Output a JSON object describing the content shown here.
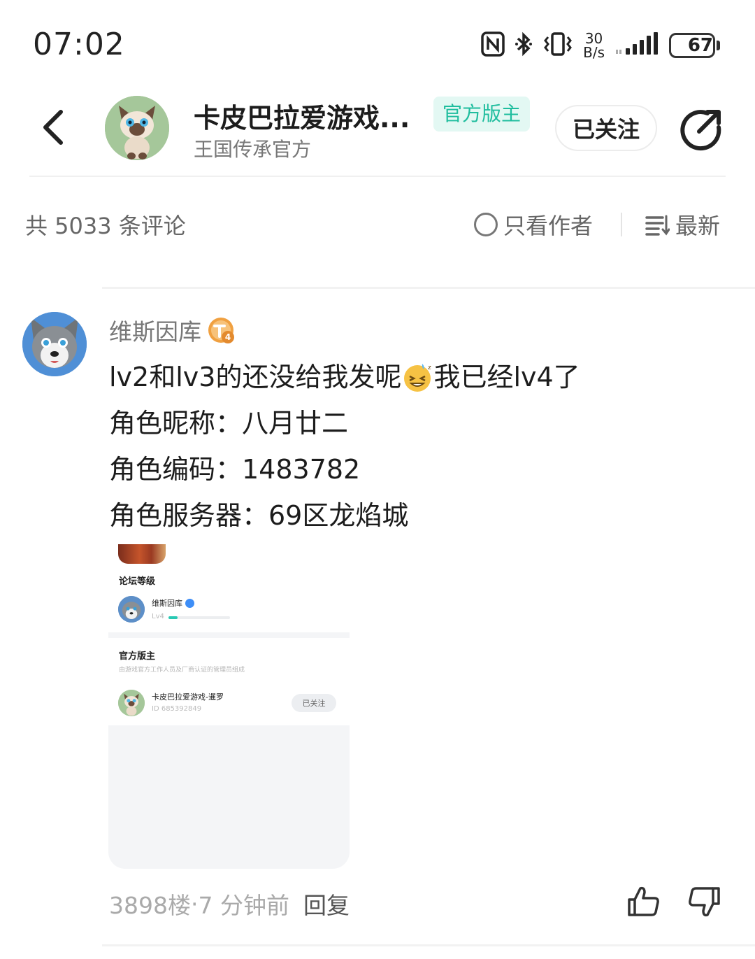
{
  "status_bar": {
    "time": "07:02",
    "net_speed_value": "30",
    "net_speed_unit": "B/s",
    "battery": "67",
    "battery_level": 0.67,
    "icons": [
      "nfc-icon",
      "bluetooth-icon",
      "vibrate-icon",
      "signal-icon",
      "battery-icon"
    ]
  },
  "header": {
    "forum_title": "卡皮巴拉爱游戏...",
    "forum_subtitle": "王国传承官方",
    "mod_badge": "官方版主",
    "follow_label": "已关注"
  },
  "filter": {
    "comment_count": "共 5033 条评论",
    "author_only": "只看作者",
    "sort": "最新"
  },
  "comment": {
    "username": "维斯因库",
    "level_badge": "4",
    "line1_a": "lv2和lv3的还没给我发呢",
    "line1_b": "我已经lv4了",
    "line2": "角色昵称：八月廿二",
    "line3": "角色编码：1483782",
    "line4": "角色服务器：69区龙焰城",
    "floor": "3898楼",
    "dot": " · ",
    "time": "7 分钟前",
    "reply": "回复"
  },
  "screenshot": {
    "section1_title": "论坛等级",
    "user_name": "维斯因库",
    "user_level": "Lv4",
    "level_progress": 0.15,
    "section2_title": "官方版主",
    "section2_desc": "由游戏官方工作人员及厂商认证的管理员组成",
    "mod_name": "卡皮巴拉爱游戏-暹罗",
    "mod_id": "ID 685392849",
    "mod_follow": "已关注"
  },
  "colors": {
    "accent": "#1fbd9e",
    "badge_bg": "#e3f8f3",
    "muted_text": "#777777",
    "level_badge": "#f0a040"
  }
}
